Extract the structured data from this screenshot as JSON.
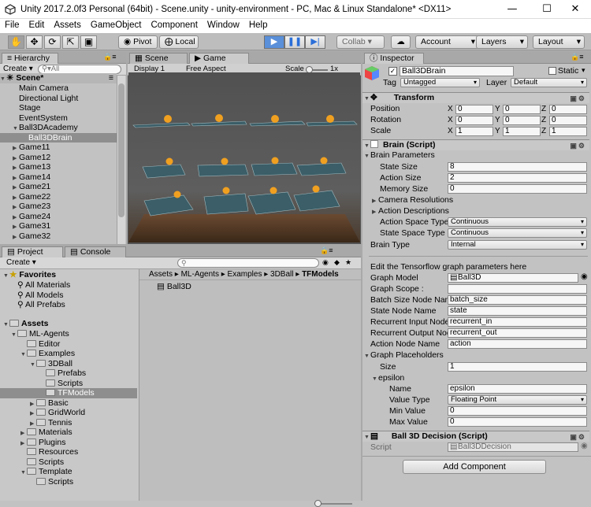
{
  "titlebar": {
    "title": "Unity 2017.2.0f3 Personal (64bit) - Scene.unity - unity-environment - PC, Mac & Linux Standalone* <DX11>",
    "minimize": "—",
    "maximize": "☐",
    "close": "✕"
  },
  "menu": [
    "File",
    "Edit",
    "Assets",
    "GameObject",
    "Component",
    "Window",
    "Help"
  ],
  "toolbar": {
    "pivot": "Pivot",
    "local": "Local",
    "collab": "Collab ▾",
    "account": "Account",
    "layers": "Layers",
    "layout": "Layout"
  },
  "hierarchy": {
    "tab": "Hierarchy",
    "create": "Create ▾",
    "search_placeholder": "All",
    "scene": "Scene*",
    "items": [
      "Main Camera",
      "Directional Light",
      "Stage",
      "EventSystem",
      "Ball3DAcademy",
      "Ball3DBrain",
      "Game11",
      "Game12",
      "Game13",
      "Game14",
      "Game21",
      "Game22",
      "Game23",
      "Game24",
      "Game31",
      "Game32"
    ]
  },
  "sceneTabs": {
    "scene": "Scene",
    "game": "Game",
    "display": "Display 1",
    "aspect": "Free Aspect",
    "scale_label": "Scale",
    "scale_value": "1x"
  },
  "project": {
    "tab": "Project",
    "console": "Console",
    "create": "Create ▾",
    "favorites": "Favorites",
    "fav_items": [
      "All Materials",
      "All Models",
      "All Prefabs"
    ],
    "assets": "Assets",
    "tree": [
      "ML-Agents",
      "Editor",
      "Examples",
      "3DBall",
      "Prefabs",
      "Scripts",
      "TFModels",
      "Basic",
      "GridWorld",
      "Tennis",
      "Materials",
      "Plugins",
      "Resources",
      "Scripts",
      "Template",
      "Scripts"
    ],
    "breadcrumb": [
      "Assets",
      "ML-Agents",
      "Examples",
      "3DBall",
      "TFModels"
    ],
    "files": [
      "Ball3D"
    ]
  },
  "inspector": {
    "tab": "Inspector",
    "name": "Ball3DBrain",
    "static": "Static",
    "tag_label": "Tag",
    "tag": "Untagged",
    "layer_label": "Layer",
    "layer": "Default",
    "transform": "Transform",
    "position": "Position",
    "rotation": "Rotation",
    "scale": "Scale",
    "pos": [
      "0",
      "0",
      "0"
    ],
    "rot": [
      "0",
      "0",
      "0"
    ],
    "scl": [
      "1",
      "1",
      "1"
    ],
    "brain_script": "Brain (Script)",
    "brain_params": "Brain Parameters",
    "state_size_label": "State Size",
    "state_size": "8",
    "action_size_label": "Action Size",
    "action_size": "2",
    "memory_size_label": "Memory Size",
    "memory_size": "0",
    "camera_res": "Camera Resolutions",
    "action_desc": "Action Descriptions",
    "action_space_label": "Action Space Type",
    "action_space": "Continuous",
    "state_space_label": "State Space Type",
    "state_space": "Continuous",
    "brain_type_label": "Brain Type",
    "brain_type": "Internal",
    "tf_note": "Edit the Tensorflow graph parameters here",
    "graph_model_label": "Graph Model",
    "graph_model": "Ball3D",
    "graph_scope_label": "Graph Scope :",
    "graph_scope": "",
    "batch_label": "Batch Size Node Nam",
    "batch": "batch_size",
    "state_node_label": "State Node Name",
    "state_node": "state",
    "rec_in_label": "Recurrent Input Node",
    "rec_in": "recurrent_in",
    "rec_out_label": "Recurrent Output Nod",
    "rec_out": "recurrent_out",
    "action_node_label": "Action Node Name",
    "action_node": "action",
    "placeholders": "Graph Placeholders",
    "size_label": "Size",
    "size": "1",
    "epsilon": "epsilon",
    "name_label": "Name",
    "name_val": "epsilon",
    "value_type_label": "Value Type",
    "value_type": "Floating Point",
    "min_label": "Min Value",
    "min": "0",
    "max_label": "Max Value",
    "max": "0",
    "decision": "Ball 3D Decision (Script)",
    "script_label": "Script",
    "script": "Ball3DDecision",
    "add_component": "Add Component"
  }
}
